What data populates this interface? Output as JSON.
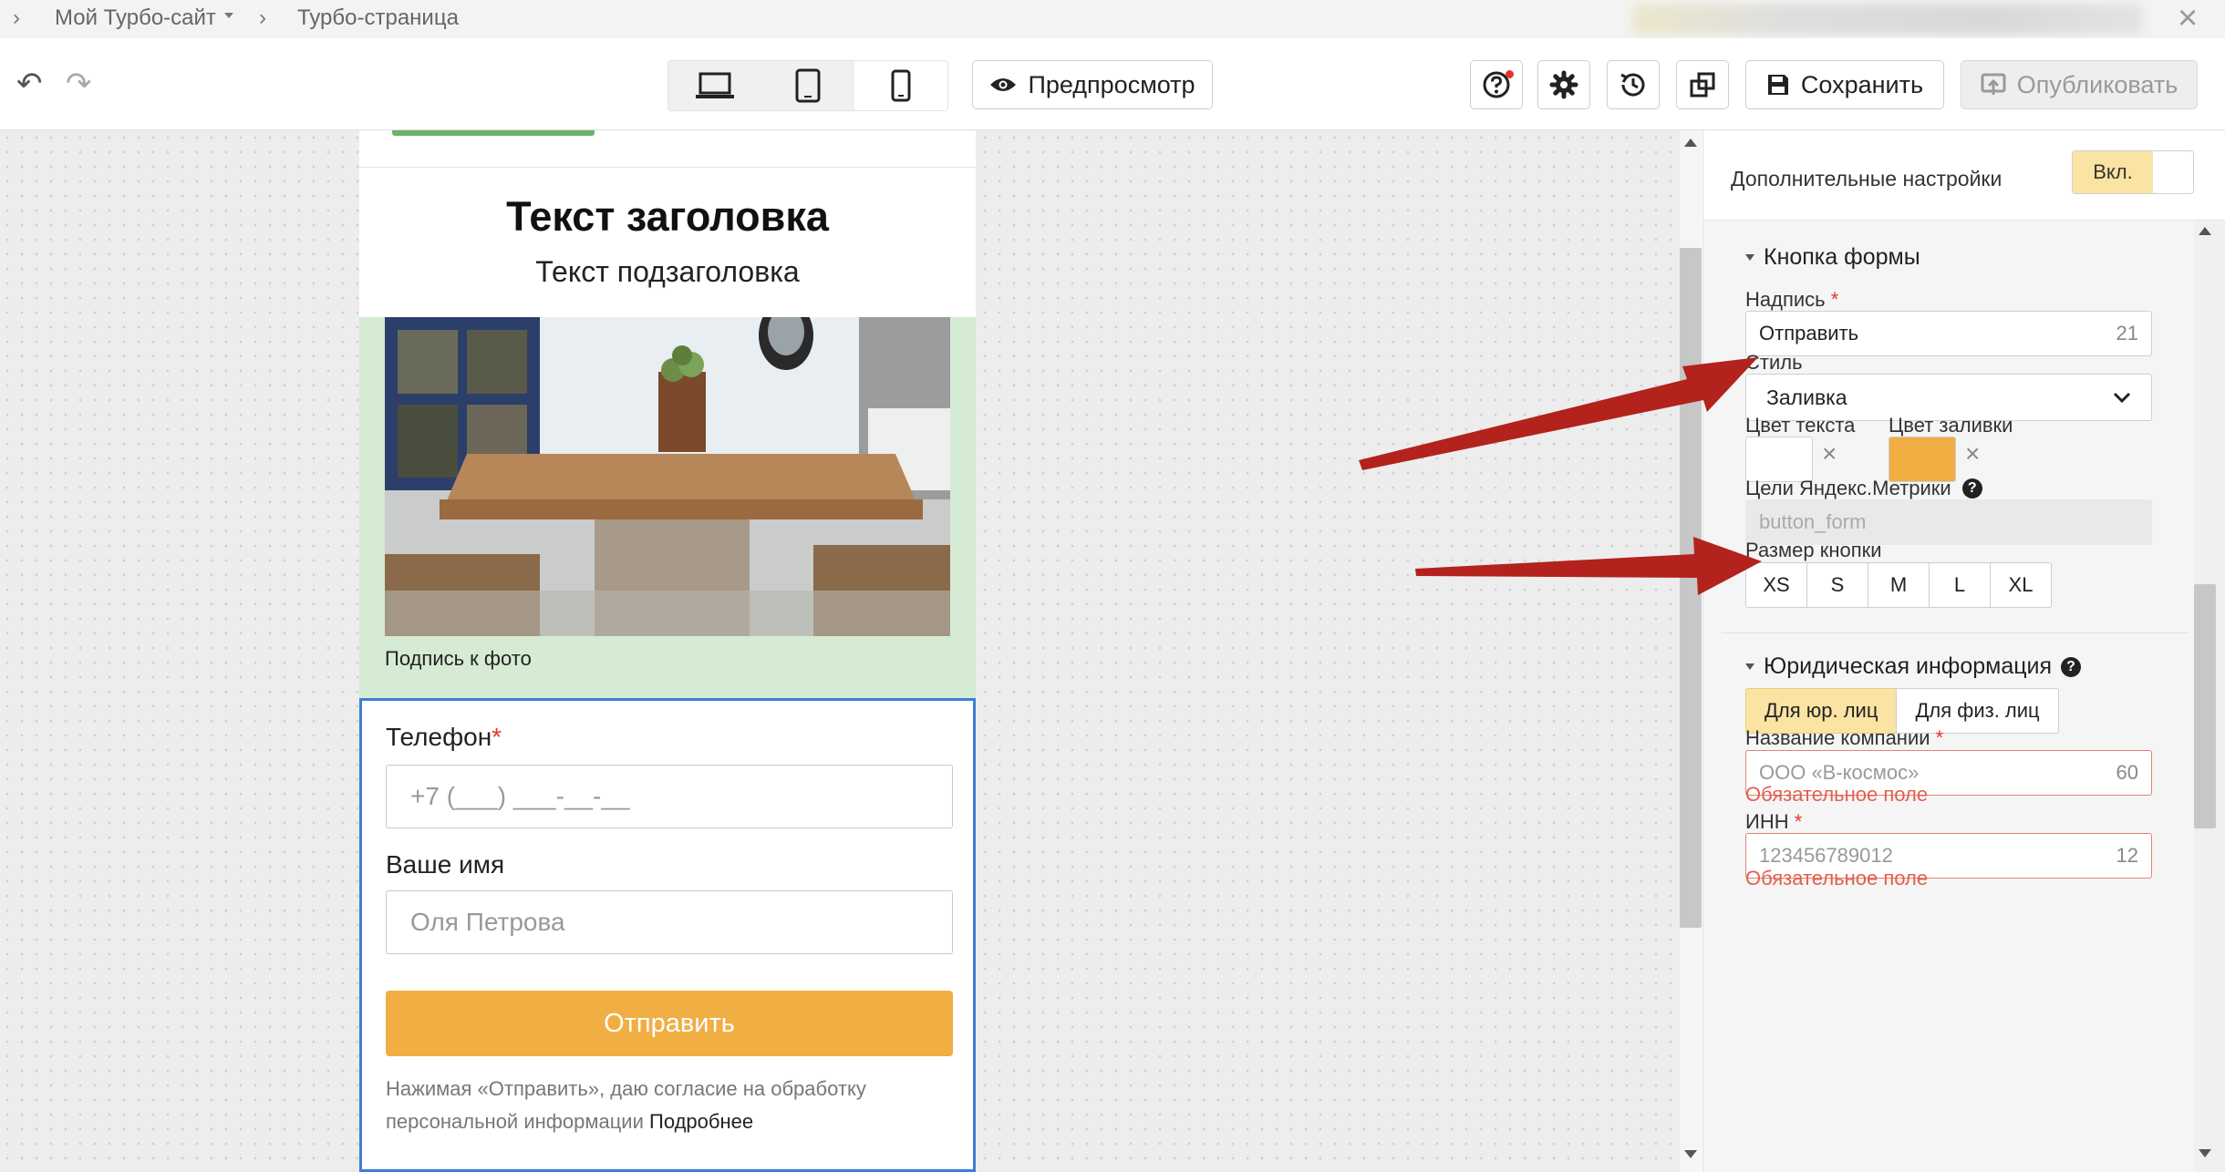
{
  "breadcrumbs": [
    "Мой Турбо-сайт",
    "Турбо-страница"
  ],
  "toolbar": {
    "preview_label": "Предпросмотр",
    "save_label": "Сохранить",
    "publish_label": "Опубликовать"
  },
  "page": {
    "title": "Текст заголовка",
    "subtitle": "Текст подзаголовка",
    "photo_caption": "Подпись к фото",
    "form": {
      "phone_label": "Телефон",
      "phone_required_mark": "*",
      "phone_placeholder": "+7 (___) ___-__-__",
      "name_label": "Ваше имя",
      "name_placeholder": "Оля Петрова",
      "submit_label": "Отправить",
      "consent_text": "Нажимая «Отправить», даю согласие на обработку персональной информации",
      "consent_link": "Подробнее"
    }
  },
  "panel": {
    "advanced_label": "Дополнительные настройки",
    "advanced_toggle": "Вкл.",
    "form_button": {
      "section_title": "Кнопка формы",
      "caption_label": "Надпись",
      "required_mark": "*",
      "caption_value": "Отправить",
      "caption_counter": "21",
      "style_label": "Стиль",
      "style_value": "Заливка",
      "text_color_label": "Цвет текста",
      "fill_color_label": "Цвет заливки",
      "text_color": "#ffffff",
      "fill_color": "#f0ae43",
      "metrika_label": "Цели Яндекс.Метрики",
      "metrika_value": "button_form",
      "size_label": "Размер кнопки",
      "sizes": [
        "XS",
        "S",
        "M",
        "L",
        "XL"
      ]
    },
    "legal": {
      "section_title": "Юридическая информация",
      "tab_legal": "Для юр. лиц",
      "tab_individual": "Для физ. лиц",
      "company_label": "Название компании",
      "company_placeholder": "ООО «В-космос»",
      "company_counter": "60",
      "required_error": "Обязательное поле",
      "inn_label": "ИНН",
      "inn_placeholder": "123456789012",
      "inn_counter": "12"
    }
  },
  "colors": {
    "accent": "#f0ae43",
    "selection": "#3c7fd6",
    "error": "#e1604f",
    "arrow": "#b3221d"
  }
}
